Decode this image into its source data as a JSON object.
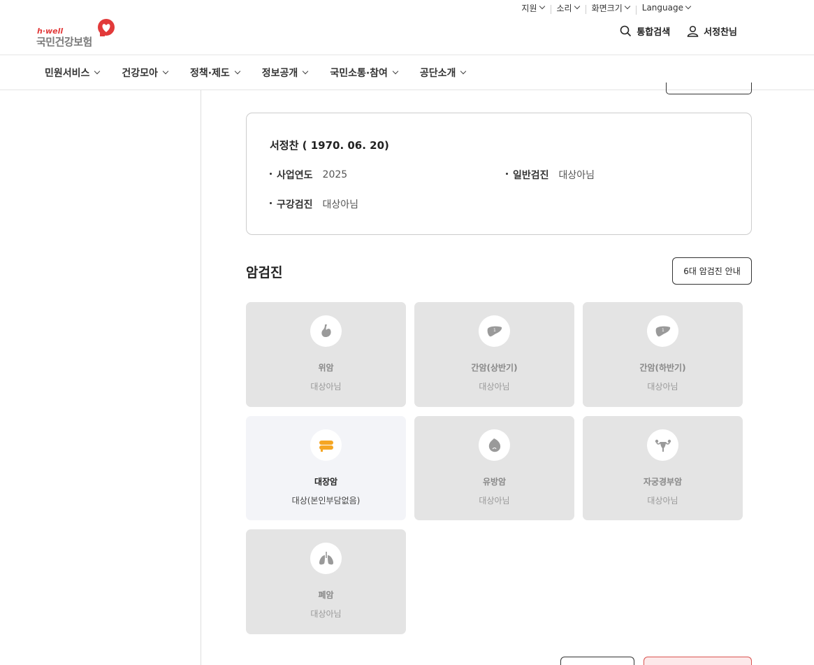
{
  "util_nav": [
    {
      "label": "지원"
    },
    {
      "label": "소리"
    },
    {
      "label": "화면크기"
    },
    {
      "label": "Language"
    }
  ],
  "logo": {
    "sub": "h·well",
    "name": "국민건강보험"
  },
  "header": {
    "search_label": "통합검색",
    "user_label": "서정찬님"
  },
  "gnb": [
    {
      "label": "민원서비스"
    },
    {
      "label": "건강모아"
    },
    {
      "label": "정책·제도"
    },
    {
      "label": "정보공개"
    },
    {
      "label": "국민소통·참여"
    },
    {
      "label": "공단소개"
    }
  ],
  "person": {
    "title": "서정찬 ( 1970. 06. 20)",
    "biz_year_label": "사업연도",
    "biz_year": "2025",
    "general_label": "일반검진",
    "general": "대상아님",
    "oral_label": "구강검진",
    "oral": "대상아님"
  },
  "cancer": {
    "title": "암검진",
    "guide_button": "6대 암검진 안내",
    "items": [
      {
        "name": "위암",
        "status": "대상아님",
        "icon": "stomach-icon"
      },
      {
        "name": "간암(상반기)",
        "status": "대상아님",
        "icon": "liver-icon"
      },
      {
        "name": "간암(하반기)",
        "status": "대상아님",
        "icon": "liver-icon"
      },
      {
        "name": "대장암",
        "status": "대상(본인부담없음)",
        "icon": "colon-icon"
      },
      {
        "name": "유방암",
        "status": "대상아님",
        "icon": "breast-icon"
      },
      {
        "name": "자궁경부암",
        "status": "대상아님",
        "icon": "uterus-icon"
      },
      {
        "name": "폐암",
        "status": "대상아님",
        "icon": "lung-icon"
      }
    ]
  },
  "colors": {
    "brand_red": "#e23a3a",
    "active_icon": "#f5a623",
    "inactive_icon": "#9a9a9a"
  }
}
